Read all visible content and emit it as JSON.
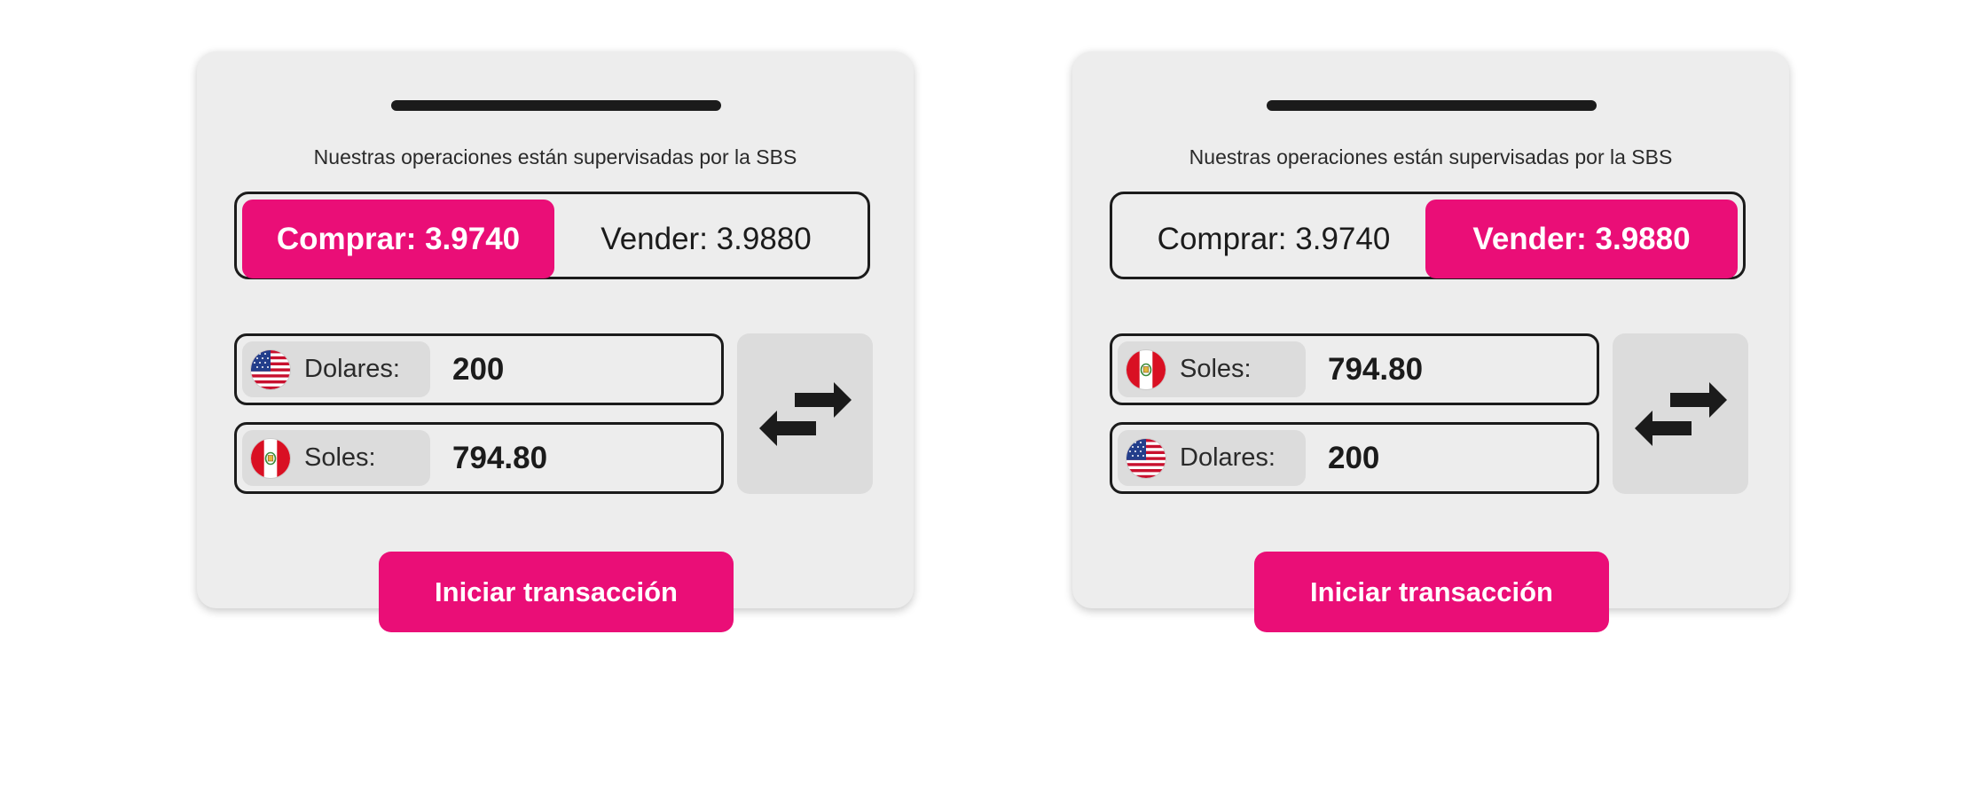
{
  "colors": {
    "accent": "#ea0e77",
    "card": "#ededed",
    "pill": "#dcdcdc",
    "ink": "#1b1b1b"
  },
  "cards": [
    {
      "notice": "Nuestras operaciones están supervisadas por la SBS",
      "buy_label": "Comprar: 3.9740",
      "sell_label": "Vender: 3.9880",
      "selected_rate": "buy",
      "fields": [
        {
          "flag_icon": "us-flag-icon",
          "label": "Dolares:",
          "value": "200"
        },
        {
          "flag_icon": "peru-flag-icon",
          "label": "Soles:",
          "value": "794.80"
        }
      ],
      "swap_icon": "swap-arrows-icon",
      "cta_label": "Iniciar transacción"
    },
    {
      "notice": "Nuestras operaciones están supervisadas por la SBS",
      "buy_label": "Comprar: 3.9740",
      "sell_label": "Vender: 3.9880",
      "selected_rate": "sell",
      "fields": [
        {
          "flag_icon": "peru-flag-icon",
          "label": "Soles:",
          "value": "794.80"
        },
        {
          "flag_icon": "us-flag-icon",
          "label": "Dolares:",
          "value": "200"
        }
      ],
      "swap_icon": "swap-arrows-icon",
      "cta_label": "Iniciar transacción"
    }
  ]
}
